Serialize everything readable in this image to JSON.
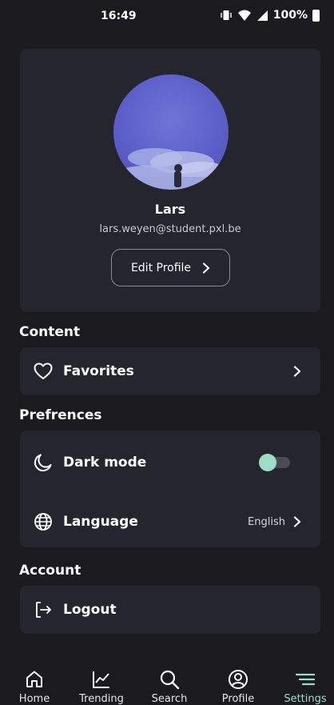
{
  "status_bar": {
    "time": "16:49",
    "battery": "100%"
  },
  "profile": {
    "name": "Lars",
    "email": "lars.weyen@student.pxl.be",
    "edit_button_label": "Edit Profile"
  },
  "sections": {
    "content_title": "Content",
    "preferences_title": "Prefrences",
    "account_title": "Account"
  },
  "content_items": [
    {
      "label": "Favorites",
      "icon": "heart-icon"
    }
  ],
  "preference_items": [
    {
      "label": "Dark mode",
      "icon": "moon-icon",
      "toggle_on": true
    },
    {
      "label": "Language",
      "icon": "globe-icon",
      "value": "English"
    }
  ],
  "account_items": [
    {
      "label": "Logout",
      "icon": "logout-icon"
    }
  ],
  "nav": {
    "items": [
      {
        "label": "Home",
        "icon": "home-icon"
      },
      {
        "label": "Trending",
        "icon": "trending-icon"
      },
      {
        "label": "Search",
        "icon": "search-icon"
      },
      {
        "label": "Profile",
        "icon": "profile-icon"
      },
      {
        "label": "Settings",
        "icon": "menu-icon",
        "active": true
      }
    ]
  },
  "colors": {
    "background": "#1a1a1f",
    "card": "#25252e",
    "accent": "#9fdcc5"
  }
}
